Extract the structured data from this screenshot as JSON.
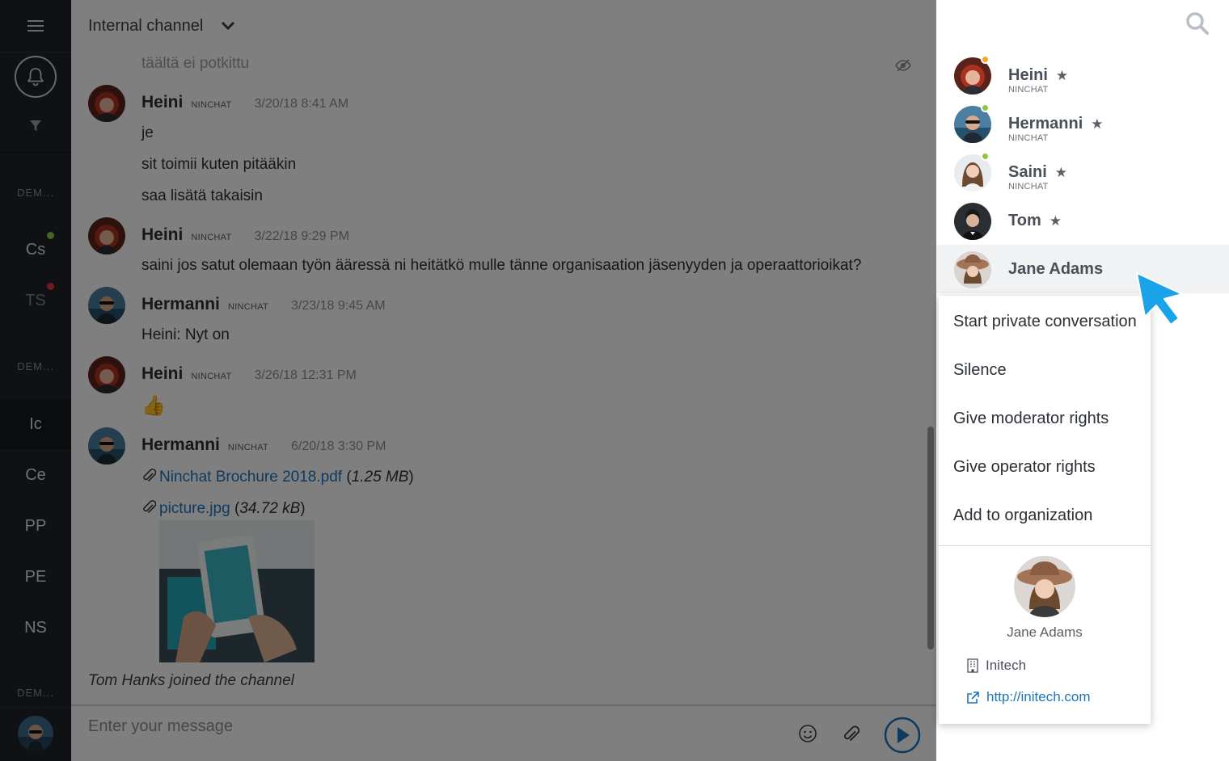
{
  "sidebar": {
    "sections": [
      "DEM...",
      "DEM...",
      "DEM..."
    ],
    "items": [
      {
        "label": "Cs",
        "dot": "#8dc63f"
      },
      {
        "label": "TS",
        "dot": "#e53935"
      },
      {
        "label": "Ic"
      },
      {
        "label": "Ce"
      },
      {
        "label": "PP"
      },
      {
        "label": "PE"
      },
      {
        "label": "NS"
      }
    ]
  },
  "chat": {
    "channel_title": "Internal channel",
    "system_notice": "täältä ei potkittu",
    "messages": [
      {
        "name": "Heini",
        "org": "NINCHAT",
        "time": "3/20/18 8:41 AM",
        "lines": [
          "je",
          "sit toimii kuten pitääkin",
          "saa lisätä takaisin"
        ]
      },
      {
        "name": "Heini",
        "org": "NINCHAT",
        "time": "3/22/18 9:29 PM",
        "lines": [
          "saini jos satut olemaan työn ääressä ni heitätkö mulle tänne organisaation jäsenyyden ja operaattorioikat?"
        ]
      },
      {
        "name": "Hermanni",
        "org": "NINCHAT",
        "time": "3/23/18 9:45 AM",
        "lines": [
          "Heini: Nyt on"
        ]
      },
      {
        "name": "Heini",
        "org": "NINCHAT",
        "time": "3/26/18 12:31 PM",
        "lines": [
          "👍"
        ]
      },
      {
        "name": "Hermanni",
        "org": "NINCHAT",
        "time": "6/20/18 3:30 PM",
        "attachments": [
          {
            "file": "Ninchat Brochure 2018.pdf",
            "size": "1.25 MB"
          },
          {
            "file": "picture.jpg",
            "size": "34.72 kB"
          }
        ]
      }
    ],
    "joined_notice": "Tom Hanks joined the channel",
    "composer_placeholder": "Enter your message"
  },
  "members": [
    {
      "name": "Heini",
      "org": "NINCHAT",
      "star": "★",
      "status": "#f5a623"
    },
    {
      "name": "Hermanni",
      "org": "NINCHAT",
      "star": "★",
      "status": "#8dc63f"
    },
    {
      "name": "Saini",
      "org": "NINCHAT",
      "star": "★",
      "status": "#8dc63f"
    },
    {
      "name": "Tom",
      "org": "",
      "star": "★"
    },
    {
      "name": "Jane Adams",
      "org": ""
    }
  ],
  "context_menu": {
    "items": [
      "Start private conversation",
      "Silence",
      "Give moderator rights",
      "Give operator rights",
      "Add to organization"
    ],
    "profile": {
      "name": "Jane Adams",
      "organization": "Initech",
      "url": "http://initech.com"
    }
  },
  "colors": {
    "accent": "#1b75bc",
    "cursor": "#1aa3e8",
    "sidebar_bg": "#1f2328"
  }
}
